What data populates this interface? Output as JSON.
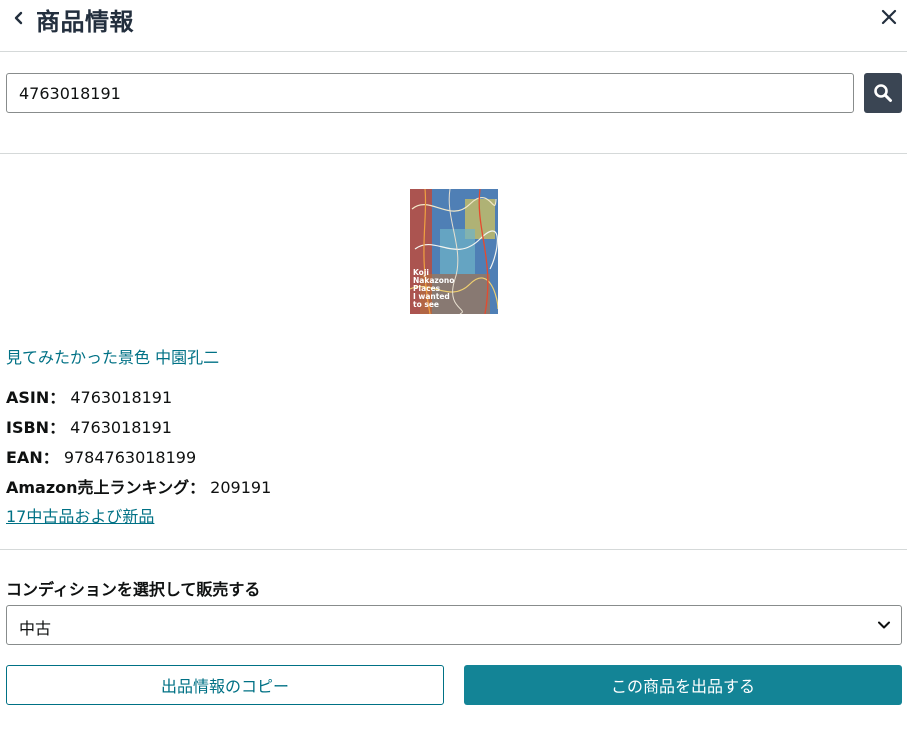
{
  "header": {
    "title": "商品情報",
    "back_icon": "chevron-left-icon",
    "close_icon": "close-icon"
  },
  "search": {
    "value": "4763018191",
    "icon": "search-icon"
  },
  "product": {
    "title": "見てみたかった景色 中園孔二",
    "cover_text": [
      "Koji",
      "Nakazono",
      "Places",
      "I wanted",
      "to see"
    ],
    "asin_label": "ASIN：",
    "asin": "4763018191",
    "isbn_label": "ISBN：",
    "isbn": "4763018191",
    "ean_label": "EAN：",
    "ean": "9784763018199",
    "rank_label": "Amazon売上ランキング：",
    "rank": "209191",
    "offers_link": "17中古品および新品"
  },
  "condition": {
    "label": "コンディションを選択して販売する",
    "selected": "中古",
    "icon": "chevron-down-icon"
  },
  "actions": {
    "copy_label": "出品情報のコピー",
    "list_label": "この商品を出品する"
  },
  "colors": {
    "link": "#007185",
    "primary_button": "#138496",
    "search_button": "#3a4553",
    "title": "#232f3e"
  }
}
